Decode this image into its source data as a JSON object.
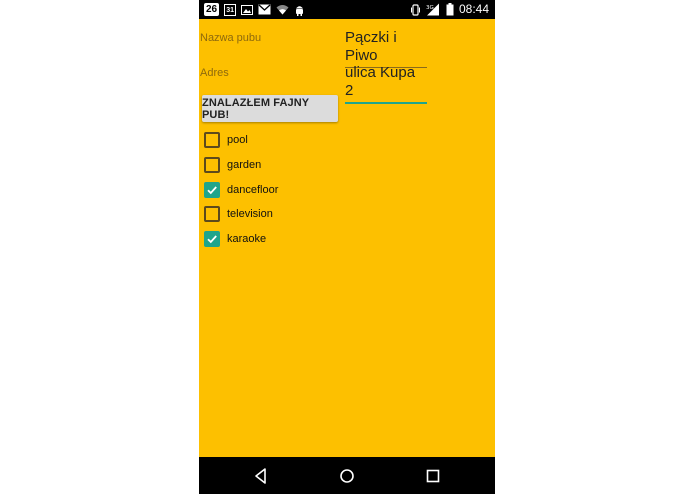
{
  "statusbar": {
    "date_badge": "26",
    "calendar_day": "31",
    "time": "08:44",
    "network": "3G"
  },
  "form": {
    "name_label": "Nazwa pubu",
    "name_value": "Pączki i Piwo",
    "address_label": "Adres",
    "address_value": "ulica Kupa 2",
    "submit_label": "ZNALAZŁEM FAJNY PUB!"
  },
  "options": [
    {
      "label": "pool",
      "checked": false
    },
    {
      "label": "garden",
      "checked": false
    },
    {
      "label": "dancefloor",
      "checked": true
    },
    {
      "label": "television",
      "checked": false
    },
    {
      "label": "karaoke",
      "checked": true
    }
  ],
  "colors": {
    "background": "#FDC000",
    "accent": "#1fa58b"
  },
  "icons": [
    "image-icon",
    "gmail-icon",
    "wifi-icon",
    "android-icon",
    "vibrate-icon",
    "signal-icon",
    "battery-icon",
    "back-icon",
    "home-icon",
    "recents-icon"
  ]
}
